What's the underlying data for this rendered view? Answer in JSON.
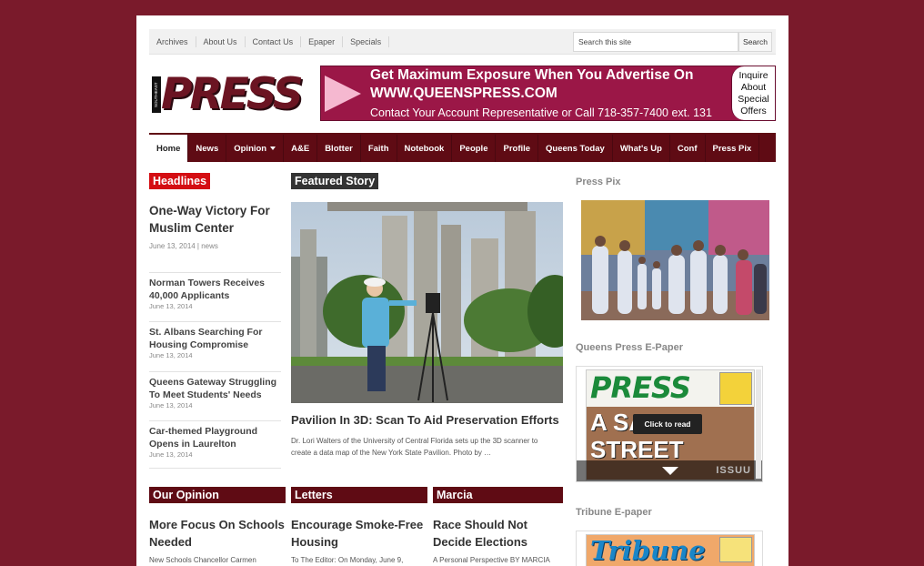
{
  "topnav": [
    "Archives",
    "About Us",
    "Contact Us",
    "Epaper",
    "Specials"
  ],
  "search": {
    "placeholder": "Search this site",
    "button": "Search"
  },
  "logo": {
    "text": "PRESS",
    "tagline": "SOUTHEAST QUEENS"
  },
  "ad": {
    "line1": "Get Maximum Exposure When You Advertise On",
    "line2": "WWW.QUEENSPRESS.COM",
    "line3": "Contact Your Account Representative or Call 718-357-7400 ext. 131",
    "offer": [
      "Inquire",
      "About",
      "Special",
      "Offers"
    ]
  },
  "mainnav": [
    "Home",
    "News",
    "Opinion",
    "A&E",
    "Blotter",
    "Faith",
    "Notebook",
    "People",
    "Profile",
    "Queens Today",
    "What's Up",
    "Conf",
    "Press Pix"
  ],
  "headlines": {
    "heading": "Headlines",
    "lead": {
      "title": "One-Way Victory For Muslim Center",
      "meta": "June 13, 2014 | news"
    },
    "items": [
      {
        "title": "Norman Towers Receives 40,000 Applicants",
        "date": "June 13, 2014"
      },
      {
        "title": "St. Albans Searching For Housing Compromise",
        "date": "June 13, 2014"
      },
      {
        "title": "Queens Gateway Struggling To Meet Students' Needs",
        "date": "June 13, 2014"
      },
      {
        "title": "Car-themed Playground Opens in Laurelton",
        "date": "June 13, 2014"
      }
    ]
  },
  "featured": {
    "heading": "Featured Story",
    "title": "Pavilion In 3D: Scan To Aid Preservation Efforts",
    "desc": "Dr. Lori Walters of the University of Central Florida sets up the 3D scanner to create a data map of the New York State Pavilion. Photo by …"
  },
  "sidebar": {
    "press_pix": "Press Pix",
    "epaper_heading": "Queens Press E-Paper",
    "epaper_cover_title": "PRESS",
    "epaper_headline_1": "A SAFER",
    "epaper_headline_2": "STREET",
    "epaper_click": "Click to read",
    "epaper_brand": "ISSUU",
    "tribune_heading": "Tribune E-paper",
    "tribune_cover_title": "Tribune"
  },
  "bottom": [
    {
      "heading": "Our Opinion",
      "title": "More Focus On Schools Needed",
      "desc": "New Schools Chancellor Carmen"
    },
    {
      "heading": "Letters",
      "title": "Encourage Smoke-Free Housing",
      "desc": "To The Editor: On Monday, June 9,"
    },
    {
      "heading": "Marcia",
      "title": "Race Should Not Decide Elections",
      "desc": "A Personal Perspective BY MARCIA"
    }
  ],
  "colors": {
    "background": "#7a1a2b",
    "nav": "#5f0b14",
    "headlines_red": "#d40e13",
    "ad": "#9b1747"
  }
}
